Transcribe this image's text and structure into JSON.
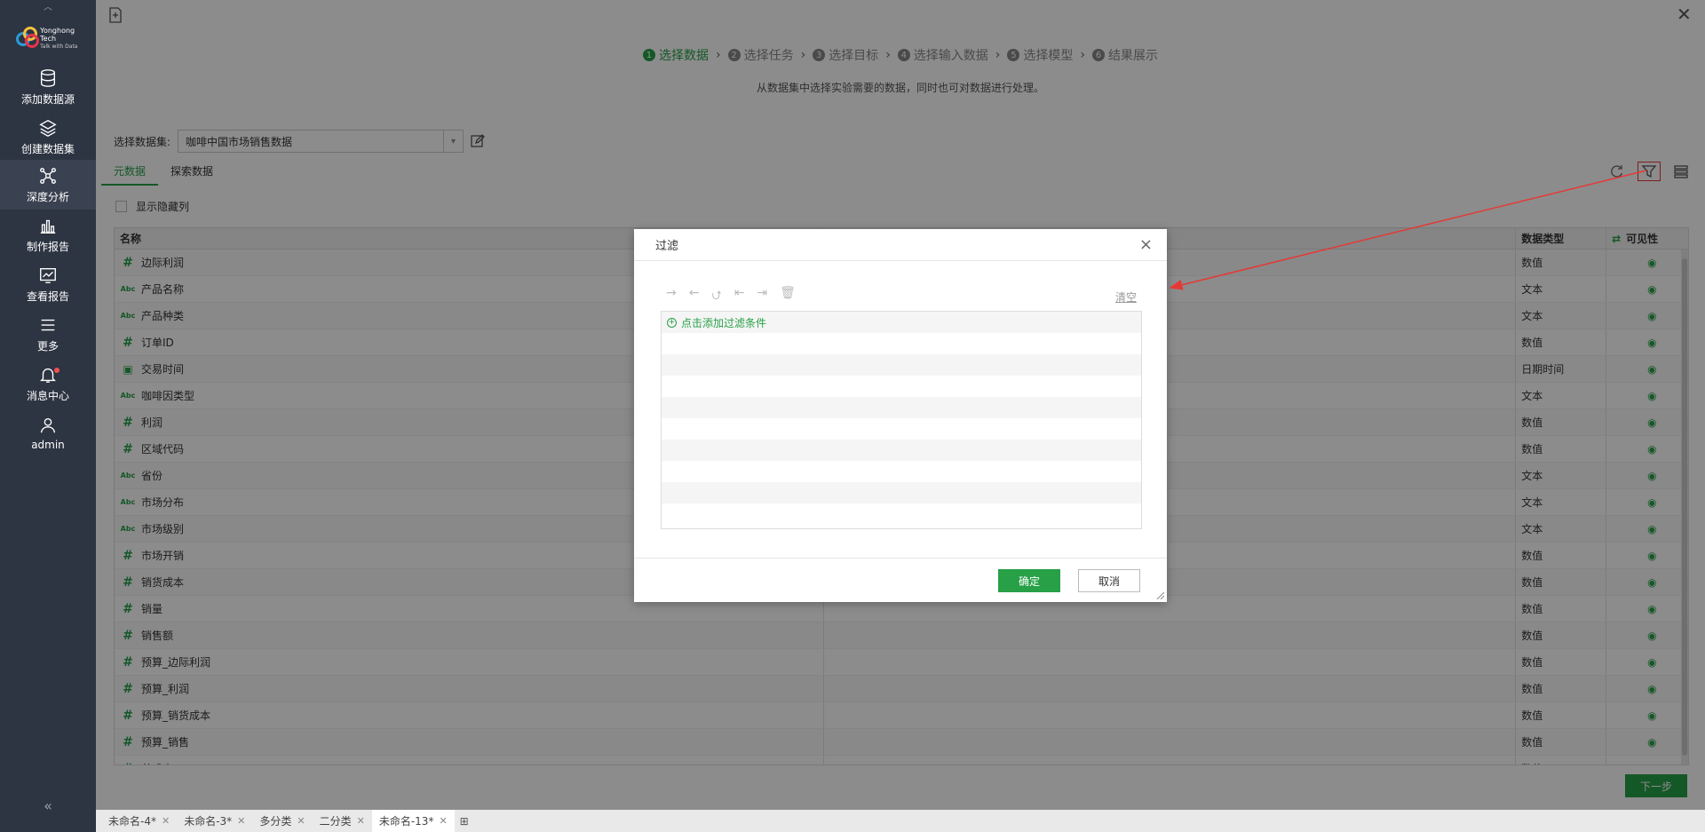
{
  "sidebar": {
    "logo_line1": "Yonghong Tech",
    "logo_line2": "Talk with Data",
    "items": [
      {
        "label": "添加数据源"
      },
      {
        "label": "创建数据集"
      },
      {
        "label": "深度分析"
      },
      {
        "label": "制作报告"
      },
      {
        "label": "查看报告"
      },
      {
        "label": "更多"
      },
      {
        "label": "消息中心"
      },
      {
        "label": "admin"
      }
    ]
  },
  "steps": [
    {
      "num": "1",
      "label": "选择数据"
    },
    {
      "num": "2",
      "label": "选择任务"
    },
    {
      "num": "3",
      "label": "选择目标"
    },
    {
      "num": "4",
      "label": "选择输入数据"
    },
    {
      "num": "5",
      "label": "选择模型"
    },
    {
      "num": "6",
      "label": "结果展示"
    }
  ],
  "step_desc": "从数据集中选择实验需要的数据，同时也可对数据进行处理。",
  "dataset": {
    "label": "选择数据集:",
    "value": "咖啡中国市场销售数据"
  },
  "tabs": [
    "元数据",
    "探索数据"
  ],
  "show_hidden": "显示隐藏列",
  "table": {
    "headers": {
      "name": "名称",
      "type": "数据类型",
      "visible": "可见性"
    },
    "rows": [
      {
        "kind": "num",
        "name": "边际利润",
        "type": "数值"
      },
      {
        "kind": "abc",
        "name": "产品名称",
        "type": "文本"
      },
      {
        "kind": "abc",
        "name": "产品种类",
        "type": "文本"
      },
      {
        "kind": "num",
        "name": "订单ID",
        "type": "数值"
      },
      {
        "kind": "date",
        "name": "交易时间",
        "type": "日期时间"
      },
      {
        "kind": "abc",
        "name": "咖啡因类型",
        "type": "文本"
      },
      {
        "kind": "num",
        "name": "利润",
        "type": "数值"
      },
      {
        "kind": "num",
        "name": "区域代码",
        "type": "数值"
      },
      {
        "kind": "abc",
        "name": "省份",
        "type": "文本"
      },
      {
        "kind": "abc",
        "name": "市场分布",
        "type": "文本"
      },
      {
        "kind": "abc",
        "name": "市场级别",
        "type": "文本"
      },
      {
        "kind": "num",
        "name": "市场开销",
        "type": "数值"
      },
      {
        "kind": "num",
        "name": "销货成本",
        "type": "数值"
      },
      {
        "kind": "num",
        "name": "销量",
        "type": "数值"
      },
      {
        "kind": "num",
        "name": "销售额",
        "type": "数值"
      },
      {
        "kind": "num",
        "name": "预算_边际利润",
        "type": "数值"
      },
      {
        "kind": "num",
        "name": "预算_利润",
        "type": "数值"
      },
      {
        "kind": "num",
        "name": "预算_销货成本",
        "type": "数值"
      },
      {
        "kind": "num",
        "name": "预算_销售",
        "type": "数值"
      },
      {
        "kind": "num",
        "name": "总成本",
        "type": "数值"
      }
    ]
  },
  "next_button": "下一步",
  "doc_tabs": [
    "未命名-4*",
    "未命名-3*",
    "多分类",
    "二分类",
    "未命名-13*"
  ],
  "dialog": {
    "title": "过滤",
    "clear": "清空",
    "add_condition": "点击添加过滤条件",
    "ok": "确定",
    "cancel": "取消"
  },
  "colors": {
    "accent": "#27a047",
    "sidebar_bg": "#2d3442",
    "annotation": "#e53935"
  }
}
